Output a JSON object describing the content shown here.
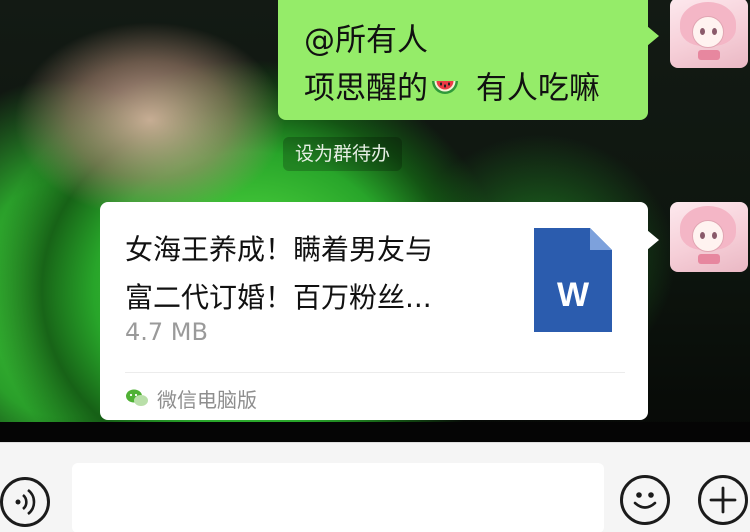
{
  "chat": {
    "message_text": {
      "line1": "@所有人",
      "line2_before": "项思醒的",
      "line2_emoji": "watermelon-emoji",
      "line2_after": " 有人吃嘛",
      "action_chip": "设为群待办"
    },
    "file_message": {
      "title_line1": "女海王养成！瞒着男友与",
      "title_line2": "富二代订婚！百万粉丝...",
      "size": "4.7 MB",
      "file_icon": "word-document-icon",
      "file_icon_letter": "W",
      "source_icon": "wechat-icon",
      "source": "微信电脑版"
    },
    "sender_avatar": "pink-anime-girl-avatar"
  },
  "input_bar": {
    "voice_icon": "voice-icon",
    "text_value": "",
    "emoji_icon": "smiley-icon",
    "more_icon": "plus-icon"
  },
  "colors": {
    "my_bubble": "#95ec69",
    "card_bg": "#ffffff",
    "word_blue": "#2b5cae",
    "input_bar_bg": "#f5f5f5"
  }
}
